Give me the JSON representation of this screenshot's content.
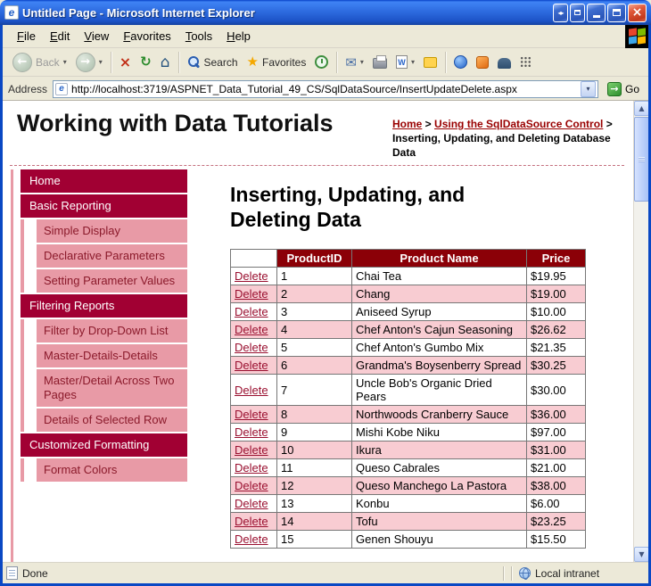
{
  "window": {
    "title": "Untitled Page - Microsoft Internet Explorer",
    "status_left": "Done",
    "status_right": "Local intranet"
  },
  "menu": {
    "items": [
      "File",
      "Edit",
      "View",
      "Favorites",
      "Tools",
      "Help"
    ]
  },
  "toolbar": {
    "back_label": "Back",
    "search_label": "Search",
    "favorites_label": "Favorites",
    "address_label": "Address",
    "address_value": "http://localhost:3719/ASPNET_Data_Tutorial_49_CS/SqlDataSource/InsertUpdateDelete.aspx",
    "go_label": "Go"
  },
  "icons": {
    "back": "←",
    "forward": "→",
    "stop": "×",
    "refresh": "↻",
    "home": "⌂",
    "favorites_star": "★",
    "mail": "✉",
    "edit_w": "W",
    "dropdown": "▾",
    "scroll_up": "▲",
    "scroll_down": "▼",
    "go": "→",
    "caption_restore_pair": "◂▸",
    "close": "×",
    "ie_e": "e"
  },
  "page": {
    "site_title": "Working with Data Tutorials",
    "breadcrumb": [
      {
        "label": "Home",
        "link": true
      },
      {
        "label": " > ",
        "link": false
      },
      {
        "label": "Using the SqlDataSource Control",
        "link": true
      },
      {
        "label": " > Inserting, Updating, and Deleting Database Data",
        "link": false
      }
    ],
    "heading": "Inserting, Updating, and Deleting Data",
    "sidebar": [
      {
        "label": "Home",
        "type": "section"
      },
      {
        "label": "Basic Reporting",
        "type": "section"
      },
      {
        "label": "Simple Display",
        "type": "item"
      },
      {
        "label": "Declarative Parameters",
        "type": "item"
      },
      {
        "label": "Setting Parameter Values",
        "type": "item"
      },
      {
        "label": "Filtering Reports",
        "type": "section"
      },
      {
        "label": "Filter by Drop-Down List",
        "type": "item"
      },
      {
        "label": "Master-Details-Details",
        "type": "item"
      },
      {
        "label": "Master/Detail Across Two Pages",
        "type": "item"
      },
      {
        "label": "Details of Selected Row",
        "type": "item"
      },
      {
        "label": "Customized Formatting",
        "type": "section"
      },
      {
        "label": "Format Colors",
        "type": "item"
      }
    ],
    "table": {
      "delete_label": "Delete",
      "headers": [
        "",
        "ProductID",
        "Product Name",
        "Price"
      ],
      "rows": [
        {
          "id": "1",
          "name": "Chai Tea",
          "price": "$19.95"
        },
        {
          "id": "2",
          "name": "Chang",
          "price": "$19.00"
        },
        {
          "id": "3",
          "name": "Aniseed Syrup",
          "price": "$10.00"
        },
        {
          "id": "4",
          "name": "Chef Anton's Cajun Seasoning",
          "price": "$26.62"
        },
        {
          "id": "5",
          "name": "Chef Anton's Gumbo Mix",
          "price": "$21.35"
        },
        {
          "id": "6",
          "name": "Grandma's Boysenberry Spread",
          "price": "$30.25"
        },
        {
          "id": "7",
          "name": "Uncle Bob's Organic Dried Pears",
          "price": "$30.00"
        },
        {
          "id": "8",
          "name": "Northwoods Cranberry Sauce",
          "price": "$36.00"
        },
        {
          "id": "9",
          "name": "Mishi Kobe Niku",
          "price": "$97.00"
        },
        {
          "id": "10",
          "name": "Ikura",
          "price": "$31.00"
        },
        {
          "id": "11",
          "name": "Queso Cabrales",
          "price": "$21.00"
        },
        {
          "id": "12",
          "name": "Queso Manchego La Pastora",
          "price": "$38.00"
        },
        {
          "id": "13",
          "name": "Konbu",
          "price": "$6.00"
        },
        {
          "id": "14",
          "name": "Tofu",
          "price": "$23.25"
        },
        {
          "id": "15",
          "name": "Genen Shouyu",
          "price": "$15.50"
        }
      ]
    }
  },
  "colors": {
    "titlebar-blue": "#0A48C4",
    "maroon-dark": "#8B0007",
    "nav-red": "#A10033",
    "nav-pink": "#E89AA6",
    "row-pink": "#F8CCD2",
    "link-maroon": "#990000",
    "chrome-beige": "#ECE9D8",
    "go-green": "#2D8F2D"
  }
}
